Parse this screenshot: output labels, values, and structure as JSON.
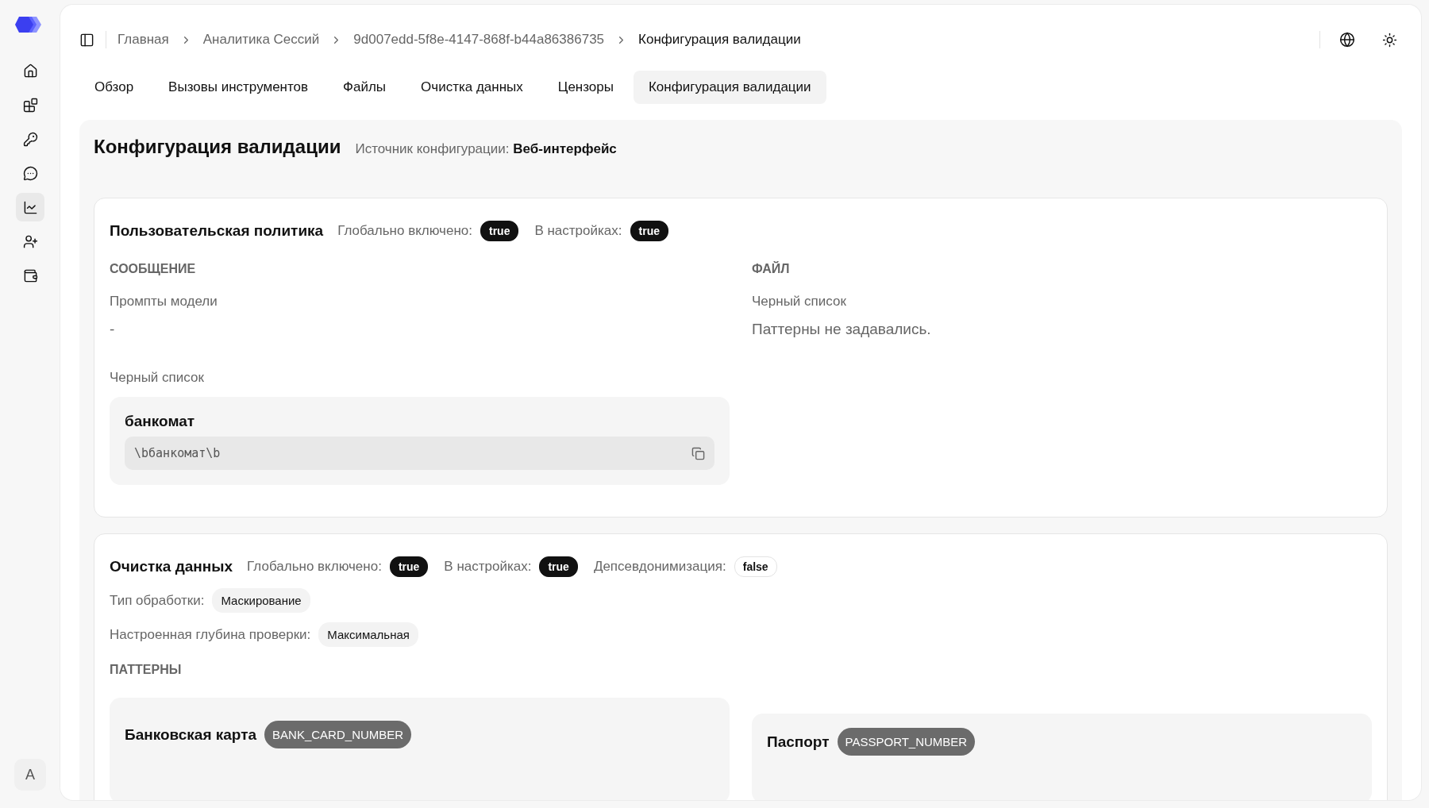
{
  "sidebar": {
    "items": [
      {
        "selected": false
      },
      {
        "selected": false
      },
      {
        "selected": false
      },
      {
        "selected": false
      },
      {
        "selected": true
      },
      {
        "selected": false
      },
      {
        "selected": false
      }
    ],
    "avatar": "A"
  },
  "breadcrumbs": [
    "Главная",
    "Аналитика Сессий",
    "9d007edd-5f8e-4147-868f-b44a86386735",
    "Конфигурация валидации"
  ],
  "tabs": [
    {
      "label": "Обзор",
      "selected": false
    },
    {
      "label": "Вызовы инструментов",
      "selected": false
    },
    {
      "label": "Файлы",
      "selected": false
    },
    {
      "label": "Очистка данных",
      "selected": false
    },
    {
      "label": "Цензоры",
      "selected": false
    },
    {
      "label": "Конфигурация валидации",
      "selected": true
    }
  ],
  "page": {
    "title": "Конфигурация валидации",
    "source_label": "Источник конфигурации:",
    "source_value": "Веб-интерфейс"
  },
  "policy": {
    "title": "Пользовательская политика",
    "flags": [
      {
        "label": "Глобально включено:",
        "value": "true",
        "on": true
      },
      {
        "label": "В настройках:",
        "value": "true",
        "on": true
      }
    ],
    "message": {
      "heading": "СООБЩЕНИЕ",
      "prompts_label": "Промпты модели",
      "prompts_value": "-",
      "blacklist_label": "Черный список",
      "entries": [
        {
          "name": "банкомат",
          "pattern": "\\bбанкомат\\b"
        }
      ]
    },
    "file": {
      "heading": "ФАЙЛ",
      "blacklist_label": "Черный список",
      "empty": "Паттерны не задавались."
    }
  },
  "cleanup": {
    "title": "Очистка данных",
    "flags": [
      {
        "label": "Глобально включено:",
        "value": "true",
        "on": true
      },
      {
        "label": "В настройках:",
        "value": "true",
        "on": true
      },
      {
        "label": "Депсевдонимизация:",
        "value": "false",
        "on": false
      }
    ],
    "fields": [
      {
        "label": "Тип обработки:",
        "value": "Маскирование"
      },
      {
        "label": "Настроенная глубина проверки:",
        "value": "Максимальная"
      }
    ],
    "patterns_heading": "ПАТТЕРНЫ",
    "patterns": [
      {
        "name": "Банковская карта",
        "code": "BANK_CARD_NUMBER"
      },
      {
        "name": "Паспорт",
        "code": "PASSPORT_NUMBER"
      }
    ]
  }
}
